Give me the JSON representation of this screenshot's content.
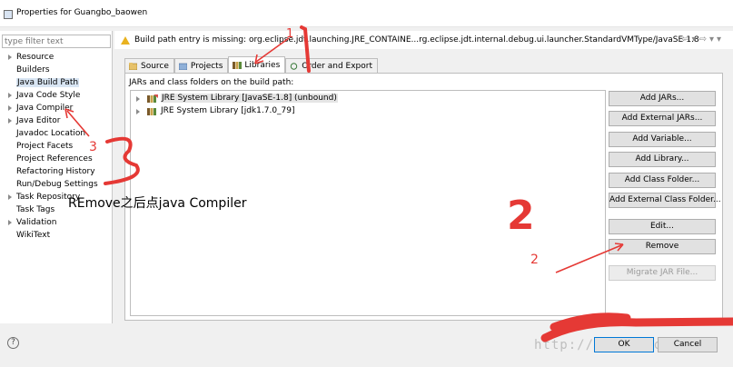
{
  "window": {
    "title": "Properties for Guangbo_baowen"
  },
  "sidebar": {
    "filter_placeholder": "type filter text",
    "items": [
      {
        "label": "Resource",
        "expandable": true,
        "selected": false
      },
      {
        "label": "Builders",
        "expandable": false,
        "selected": false
      },
      {
        "label": "Java Build Path",
        "expandable": false,
        "selected": true
      },
      {
        "label": "Java Code Style",
        "expandable": true,
        "selected": false
      },
      {
        "label": "Java Compiler",
        "expandable": true,
        "selected": false
      },
      {
        "label": "Java Editor",
        "expandable": true,
        "selected": false
      },
      {
        "label": "Javadoc Location",
        "expandable": false,
        "selected": false
      },
      {
        "label": "Project Facets",
        "expandable": false,
        "selected": false
      },
      {
        "label": "Project References",
        "expandable": false,
        "selected": false
      },
      {
        "label": "Refactoring History",
        "expandable": false,
        "selected": false
      },
      {
        "label": "Run/Debug Settings",
        "expandable": false,
        "selected": false
      },
      {
        "label": "Task Repository",
        "expandable": true,
        "selected": false
      },
      {
        "label": "Task Tags",
        "expandable": false,
        "selected": false
      },
      {
        "label": "Validation",
        "expandable": true,
        "selected": false
      },
      {
        "label": "WikiText",
        "expandable": false,
        "selected": false
      }
    ]
  },
  "header": {
    "message": "Build path entry is missing: org.eclipse.jdt.launching.JRE_CONTAINE...rg.eclipse.jdt.internal.debug.ui.launcher.StandardVMType/JavaSE-1.8"
  },
  "tabs": [
    {
      "label": "Source",
      "icon": "source-folder-icon",
      "active": false
    },
    {
      "label": "Projects",
      "icon": "project-icon",
      "active": false
    },
    {
      "label": "Libraries",
      "icon": "libraries-icon",
      "active": true
    },
    {
      "label": "Order and Export",
      "icon": "order-export-icon",
      "active": false
    }
  ],
  "panel": {
    "label": "JARs and class folders on the build path:",
    "libraries": [
      {
        "label": "JRE System Library [JavaSE-1.8] (unbound)",
        "selected": true
      },
      {
        "label": "JRE System Library [jdk1.7.0_79]",
        "selected": false
      }
    ],
    "buttons": [
      {
        "label": "Add JARs...",
        "enabled": true
      },
      {
        "label": "Add External JARs...",
        "enabled": true
      },
      {
        "label": "Add Variable...",
        "enabled": true
      },
      {
        "label": "Add Library...",
        "enabled": true
      },
      {
        "label": "Add Class Folder...",
        "enabled": true
      },
      {
        "label": "Add External Class Folder...",
        "enabled": true
      },
      {
        "label": "Edit...",
        "enabled": true
      },
      {
        "label": "Remove",
        "enabled": true
      },
      {
        "label": "Migrate JAR File...",
        "enabled": false
      }
    ]
  },
  "footer": {
    "help": "?",
    "ok": "OK",
    "cancel": "Cancel",
    "watermark": "http://blog.csdn.net/"
  },
  "annotations": {
    "caption": "REmove之后点java Compiler",
    "num1": "1",
    "num2_small": "2",
    "num2_big": "2",
    "num3": "3",
    "color": "#e53935"
  }
}
